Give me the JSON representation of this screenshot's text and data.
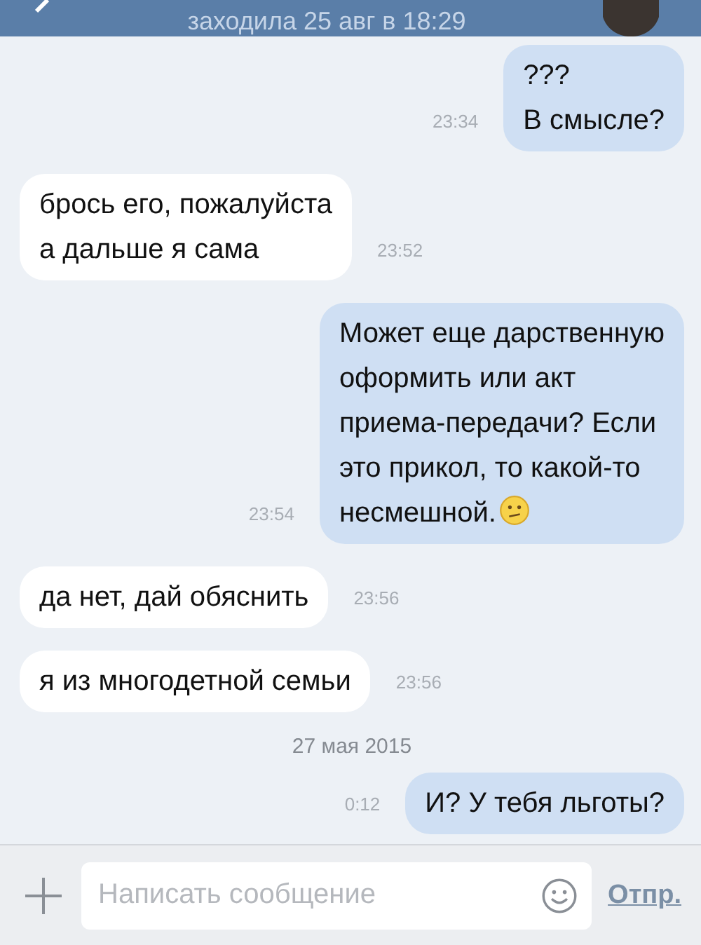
{
  "header": {
    "status": "заходила 25 авг в 18:29"
  },
  "messages": [
    {
      "kind": "out",
      "text": "???\nВ смысле?",
      "time": "23:34"
    },
    {
      "kind": "in",
      "text": "брось его, пожалуйста\nа дальше я сама",
      "time": "23:52"
    },
    {
      "kind": "out",
      "text": "Может еще дарственную\nоформить или акт\nприема-передачи? Если\nэто прикол, то какой-то\nнесмешной.",
      "time": "23:54",
      "emoji": true
    },
    {
      "kind": "in",
      "text": "да нет, дай обяснить",
      "time": "23:56"
    },
    {
      "kind": "in",
      "text": "я из многодетной семьи",
      "time": "23:56"
    },
    {
      "kind": "date",
      "text": "27 мая 2015"
    },
    {
      "kind": "out",
      "text": "И? У тебя льготы?",
      "time": "0:12"
    }
  ],
  "composer": {
    "placeholder": "Написать сообщение",
    "send": "Отпр."
  }
}
